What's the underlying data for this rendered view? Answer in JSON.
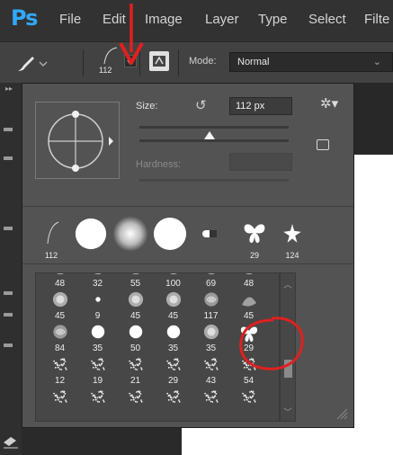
{
  "app": {
    "logo": "Ps"
  },
  "menu": [
    "File",
    "Edit",
    "Image",
    "Layer",
    "Type",
    "Select",
    "Filte"
  ],
  "options_bar": {
    "brush_size": "112",
    "mode_label": "Mode:",
    "mode_value": "Normal"
  },
  "panel": {
    "size_label": "Size:",
    "size_value": "112 px",
    "size_fraction": 0.47,
    "hardness_label": "Hardness:",
    "hardness_value": ""
  },
  "recent_brushes": [
    {
      "label": "112",
      "kind": "hard-stroke"
    },
    {
      "label": "",
      "kind": "hard-round"
    },
    {
      "label": "",
      "kind": "soft-round"
    },
    {
      "label": "",
      "kind": "hard-round"
    },
    {
      "label": "",
      "kind": "flat-tip"
    },
    {
      "label": "29",
      "kind": "butterfly"
    },
    {
      "label": "124",
      "kind": "star-leaf"
    }
  ],
  "brush_grid": [
    {
      "num": "48",
      "kind": "soft"
    },
    {
      "num": "32",
      "kind": "soft"
    },
    {
      "num": "55",
      "kind": "soft"
    },
    {
      "num": "100",
      "kind": "soft"
    },
    {
      "num": "69",
      "kind": "soft"
    },
    {
      "num": "48",
      "kind": "soft"
    },
    {
      "num": "45",
      "kind": "soft"
    },
    {
      "num": "9",
      "kind": "dot"
    },
    {
      "num": "45",
      "kind": "soft"
    },
    {
      "num": "45",
      "kind": "soft"
    },
    {
      "num": "117",
      "kind": "rose"
    },
    {
      "num": "45",
      "kind": "leaf"
    },
    {
      "num": "84",
      "kind": "rose"
    },
    {
      "num": "35",
      "kind": "hard"
    },
    {
      "num": "50",
      "kind": "hard"
    },
    {
      "num": "35",
      "kind": "hard"
    },
    {
      "num": "35",
      "kind": "soft"
    },
    {
      "num": "29",
      "kind": "butterfly"
    },
    {
      "num": "12",
      "kind": "spatter"
    },
    {
      "num": "19",
      "kind": "spatter"
    },
    {
      "num": "21",
      "kind": "spatter"
    },
    {
      "num": "29",
      "kind": "spatter"
    },
    {
      "num": "43",
      "kind": "spatter"
    },
    {
      "num": "54",
      "kind": "spatter"
    },
    {
      "num": "",
      "kind": "spatter"
    },
    {
      "num": "",
      "kind": "spatter"
    },
    {
      "num": "",
      "kind": "spatter"
    },
    {
      "num": "",
      "kind": "spatter"
    },
    {
      "num": "",
      "kind": "spatter"
    },
    {
      "num": "",
      "kind": "spatter"
    }
  ],
  "colors": {
    "accent": "#31a8ff",
    "annotation": "#e02020"
  }
}
